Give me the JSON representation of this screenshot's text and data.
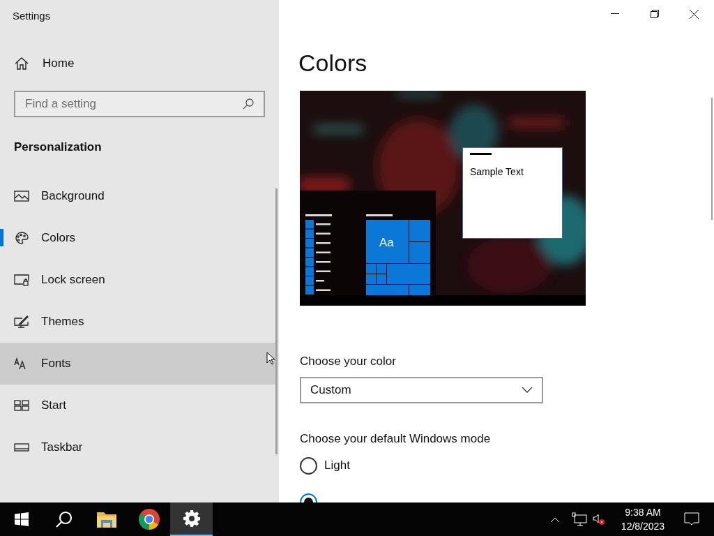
{
  "window": {
    "title": "Settings"
  },
  "sidebar": {
    "home": "Home",
    "search": {
      "placeholder": "Find a setting"
    },
    "section": "Personalization",
    "items": [
      {
        "label": "Background",
        "kind": "picture",
        "selected": false,
        "hovered": false
      },
      {
        "label": "Colors",
        "kind": "palette",
        "selected": true,
        "hovered": false
      },
      {
        "label": "Lock screen",
        "kind": "lock",
        "selected": false,
        "hovered": false
      },
      {
        "label": "Themes",
        "kind": "brush",
        "selected": false,
        "hovered": false
      },
      {
        "label": "Fonts",
        "kind": "fonts",
        "selected": false,
        "hovered": true
      },
      {
        "label": "Start",
        "kind": "start",
        "selected": false,
        "hovered": false
      },
      {
        "label": "Taskbar",
        "kind": "taskbar",
        "selected": false,
        "hovered": false
      }
    ]
  },
  "content": {
    "heading": "Colors",
    "preview": {
      "sample_text": "Sample Text",
      "tile_text": "Aa"
    },
    "color": {
      "label": "Choose your color",
      "value": "Custom"
    },
    "mode": {
      "label": "Choose your default Windows mode",
      "options": [
        {
          "label": "Light",
          "selected": false
        },
        {
          "selected": true
        }
      ]
    }
  },
  "taskbar": {
    "apps": [
      {
        "kind": "start",
        "active": false
      },
      {
        "kind": "search",
        "active": false
      },
      {
        "kind": "folder",
        "active": false
      },
      {
        "kind": "browser",
        "active": false
      },
      {
        "kind": "settings",
        "active": true
      }
    ],
    "time": "9:38 AM",
    "date": "12/8/2023"
  }
}
